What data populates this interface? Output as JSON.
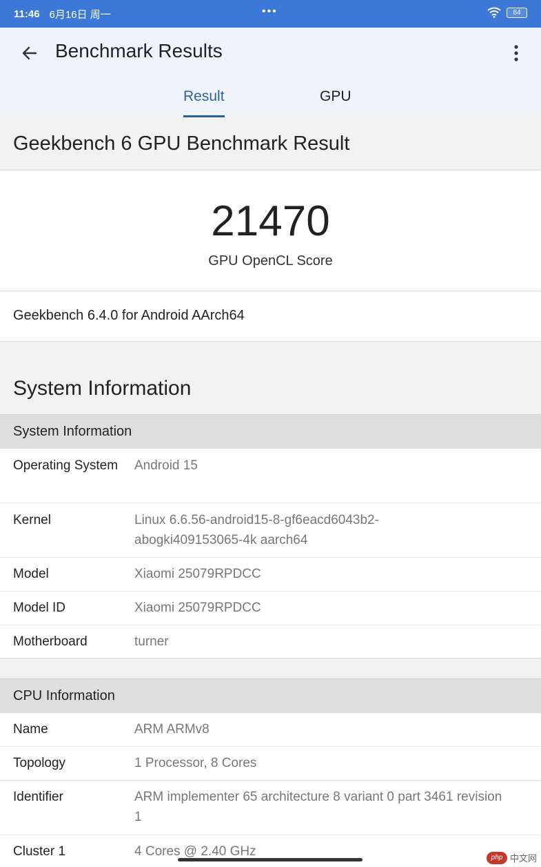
{
  "status": {
    "time": "11:46",
    "date": "6月16日 周一",
    "dots": "•••",
    "battery": "84"
  },
  "header": {
    "title": "Benchmark Results"
  },
  "tabs": [
    {
      "label": "Result"
    },
    {
      "label": "GPU"
    }
  ],
  "result": {
    "heading": "Geekbench 6 GPU Benchmark Result",
    "score": "21470",
    "score_label": "GPU OpenCL Score",
    "version": "Geekbench 6.4.0 for Android AArch64"
  },
  "system": {
    "heading": "System Information",
    "group_title": "System Information",
    "rows": [
      {
        "label": "Operating System",
        "value": "Android 15"
      },
      {
        "label": "Kernel",
        "value": "Linux 6.6.56-android15-8-gf6eacd6043b2-abogki409153065-4k aarch64"
      },
      {
        "label": "Model",
        "value": "Xiaomi 25079RPDCC"
      },
      {
        "label": "Model ID",
        "value": "Xiaomi 25079RPDCC"
      },
      {
        "label": "Motherboard",
        "value": "turner"
      }
    ]
  },
  "cpu": {
    "group_title": "CPU Information",
    "rows": [
      {
        "label": "Name",
        "value": "ARM ARMv8"
      },
      {
        "label": "Topology",
        "value": "1 Processor, 8 Cores"
      },
      {
        "label": "Identifier",
        "value": "ARM implementer 65 architecture 8 variant 0 part 3461 revision 1"
      },
      {
        "label": "Cluster 1",
        "value": "4 Cores @ 2.40 GHz"
      }
    ]
  },
  "watermark": {
    "logo": "php",
    "text": "中文网"
  },
  "colors": {
    "status_bar": "#3c78d8",
    "accent": "#2e5f9e",
    "appbar_bg": "#eef4fa"
  }
}
